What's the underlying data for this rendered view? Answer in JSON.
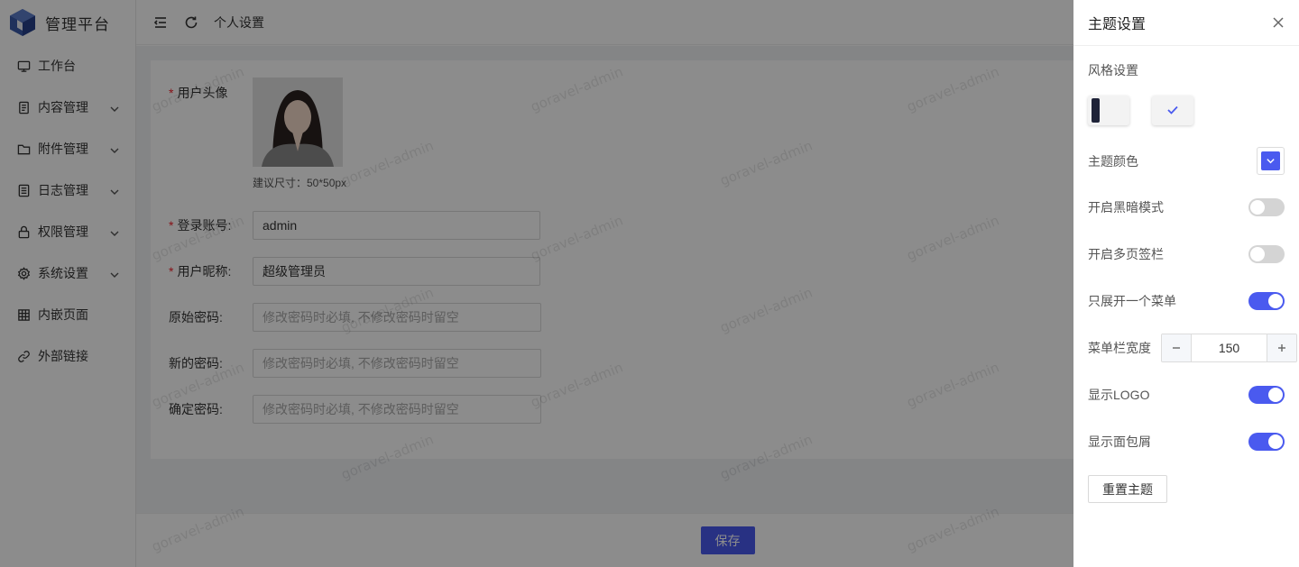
{
  "app": {
    "title": "管理平台",
    "logo_icon": "cube-logo-icon"
  },
  "sidebar": {
    "items": [
      {
        "label": "工作台",
        "icon": "monitor-icon",
        "has_children": false
      },
      {
        "label": "内容管理",
        "icon": "document-icon",
        "has_children": true
      },
      {
        "label": "附件管理",
        "icon": "folder-icon",
        "has_children": true
      },
      {
        "label": "日志管理",
        "icon": "log-icon",
        "has_children": true
      },
      {
        "label": "权限管理",
        "icon": "lock-icon",
        "has_children": true
      },
      {
        "label": "系统设置",
        "icon": "gear-icon",
        "has_children": true
      },
      {
        "label": "内嵌页面",
        "icon": "grid-icon",
        "has_children": false
      },
      {
        "label": "外部链接",
        "icon": "link-icon",
        "has_children": false
      }
    ]
  },
  "header": {
    "page_title": "个人设置"
  },
  "form": {
    "avatar_label": "用户头像",
    "avatar_hint": "建议尺寸：50*50px",
    "username_label": "登录账号:",
    "username_value": "admin",
    "nickname_label": "用户昵称:",
    "nickname_value": "超级管理员",
    "old_password_label": "原始密码:",
    "old_password_placeholder": "修改密码时必填, 不修改密码时留空",
    "new_password_label": "新的密码:",
    "new_password_placeholder": "修改密码时必填, 不修改密码时留空",
    "confirm_password_label": "确定密码:",
    "confirm_password_placeholder": "修改密码时必填, 不修改密码时留空",
    "required_mark": "*"
  },
  "footer": {
    "save_label": "保存"
  },
  "watermark": "goravel-admin",
  "drawer": {
    "title": "主题设置",
    "style_label": "风格设置",
    "style_selected": "light",
    "theme_color_label": "主题颜色",
    "theme_color": "#4a5aef",
    "dark_mode_label": "开启黑暗模式",
    "dark_mode": false,
    "multi_tab_label": "开启多页签栏",
    "multi_tab": false,
    "unique_opened_label": "只展开一个菜单",
    "unique_opened": true,
    "menu_width_label": "菜单栏宽度",
    "menu_width_value": "150",
    "show_logo_label": "显示LOGO",
    "show_logo": true,
    "show_breadcrumb_label": "显示面包屑",
    "show_breadcrumb": true,
    "reset_label": "重置主题"
  }
}
